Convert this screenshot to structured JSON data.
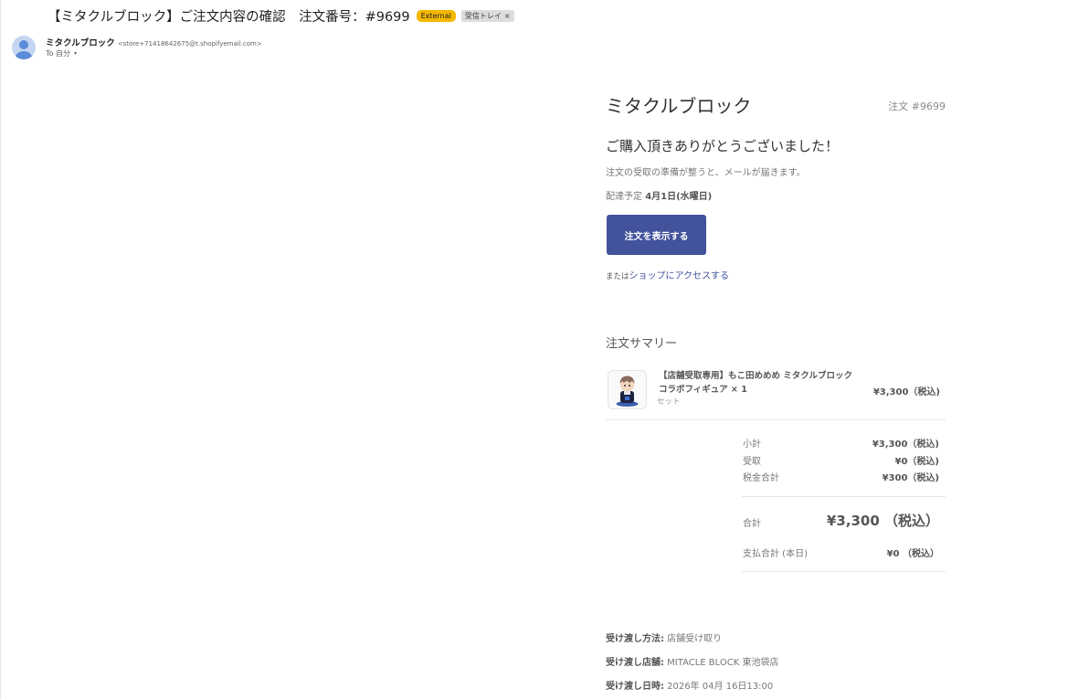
{
  "email": {
    "subject": "【ミタクルブロック】ご注文内容の確認　注文番号：#9699",
    "badge_external": "External",
    "badge_label": "受信トレイ",
    "badge_label_close": "×",
    "sender_name": "ミタクルブロック",
    "sender_email": "<store+71418642675@t.shopifyemail.com>",
    "to": "To 自分",
    "to_caret": "▾"
  },
  "order": {
    "shop_name": "ミタクルブロック",
    "order_number": "注文 #9699",
    "thanks": "ご購入頂きありがとうございました！",
    "info": "注文の受取の準備が整うと、メールが届きます。",
    "eta_label": "配達予定 ",
    "eta_value": "4月1日(水曜日)",
    "view_button": "注文を表示する",
    "or_text": "または",
    "shop_link": "ショップにアクセスする"
  },
  "summary": {
    "title": "注文サマリー",
    "item": {
      "title": "【店舗受取専用】もこ田めめめ ミタクルブロックコラボフィギュア × 1",
      "subtitle": "セット",
      "price": "¥3,300（税込)"
    },
    "subtotal_label": "小計",
    "subtotal_value": "¥3,300（税込)",
    "pickup_fee_label": "受取",
    "pickup_fee_value": "¥0（税込)",
    "tax_label": "税金合計",
    "tax_value": "¥300（税込)",
    "total_label": "合計",
    "total_value": "¥3,300 （税込）",
    "paid_label": "支払合計 (本日)",
    "paid_value": "¥0 （税込）"
  },
  "pickup": {
    "method_label": "受け渡し方法:",
    "method_value": " 店舗受け取り",
    "store_label": "受け渡し店舗:",
    "store_value": " MITACLE BLOCK 東池袋店",
    "datetime_label": "受け渡し日時:",
    "datetime_value": " 2026年 04月 16日13:00"
  }
}
